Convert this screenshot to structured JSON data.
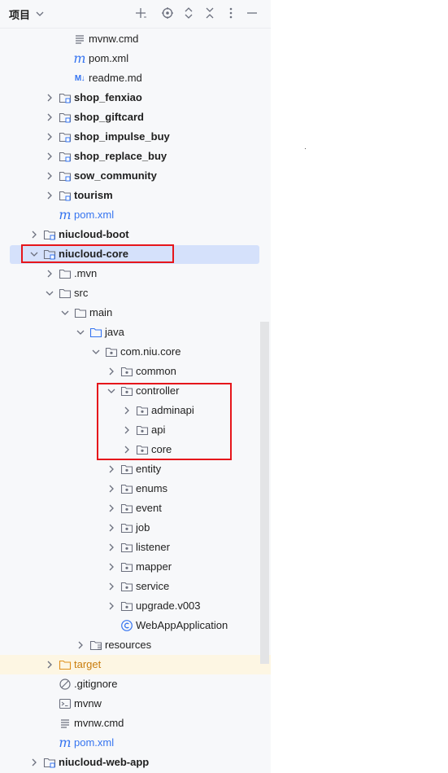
{
  "header": {
    "title": "项目",
    "icons": [
      "chevron-down-icon",
      "add-icon",
      "locate-icon",
      "expand-all-icon",
      "collapse-all-icon",
      "more-icon",
      "minimize-icon"
    ]
  },
  "tree": [
    {
      "label": "mvnw.cmd",
      "indent": 90,
      "arrow": "none",
      "icon": "lines-file-icon",
      "style": "normal"
    },
    {
      "label": "pom.xml",
      "indent": 90,
      "arrow": "none",
      "icon": "maven-icon",
      "style": "normal"
    },
    {
      "label": "readme.md",
      "indent": 90,
      "arrow": "none",
      "icon": "markdown-icon",
      "style": "normal"
    },
    {
      "label": "shop_fenxiao",
      "indent": 72,
      "arrow": "right",
      "icon": "module-folder-icon",
      "style": "bold"
    },
    {
      "label": "shop_giftcard",
      "indent": 72,
      "arrow": "right",
      "icon": "module-folder-icon",
      "style": "bold"
    },
    {
      "label": "shop_impulse_buy",
      "indent": 72,
      "arrow": "right",
      "icon": "module-folder-icon",
      "style": "bold"
    },
    {
      "label": "shop_replace_buy",
      "indent": 72,
      "arrow": "right",
      "icon": "module-folder-icon",
      "style": "bold"
    },
    {
      "label": "sow_community",
      "indent": 72,
      "arrow": "right",
      "icon": "module-folder-icon",
      "style": "bold"
    },
    {
      "label": "tourism",
      "indent": 72,
      "arrow": "right",
      "icon": "module-folder-icon",
      "style": "bold"
    },
    {
      "label": "pom.xml",
      "indent": 72,
      "arrow": "none",
      "icon": "maven-icon",
      "style": "blue"
    },
    {
      "label": "niucloud-boot",
      "indent": 53,
      "arrow": "right",
      "icon": "module-folder-icon",
      "style": "bold"
    },
    {
      "label": "niucloud-core",
      "indent": 53,
      "arrow": "down",
      "icon": "module-folder-icon",
      "style": "bold",
      "selected": true
    },
    {
      "label": ".mvn",
      "indent": 72,
      "arrow": "right",
      "icon": "folder-icon",
      "style": "normal"
    },
    {
      "label": "src",
      "indent": 72,
      "arrow": "down",
      "icon": "folder-icon",
      "style": "normal"
    },
    {
      "label": "main",
      "indent": 91,
      "arrow": "down",
      "icon": "folder-icon",
      "style": "normal"
    },
    {
      "label": "java",
      "indent": 110,
      "arrow": "down",
      "icon": "source-folder-icon",
      "style": "normal"
    },
    {
      "label": "com.niu.core",
      "indent": 129,
      "arrow": "down",
      "icon": "package-icon",
      "style": "normal"
    },
    {
      "label": "common",
      "indent": 148,
      "arrow": "right",
      "icon": "package-icon",
      "style": "normal"
    },
    {
      "label": "controller",
      "indent": 148,
      "arrow": "down",
      "icon": "package-icon",
      "style": "normal"
    },
    {
      "label": "adminapi",
      "indent": 167,
      "arrow": "right",
      "icon": "package-icon",
      "style": "normal"
    },
    {
      "label": "api",
      "indent": 167,
      "arrow": "right",
      "icon": "package-icon",
      "style": "normal"
    },
    {
      "label": "core",
      "indent": 167,
      "arrow": "right",
      "icon": "package-icon",
      "style": "normal"
    },
    {
      "label": "entity",
      "indent": 148,
      "arrow": "right",
      "icon": "package-icon",
      "style": "normal"
    },
    {
      "label": "enums",
      "indent": 148,
      "arrow": "right",
      "icon": "package-icon",
      "style": "normal"
    },
    {
      "label": "event",
      "indent": 148,
      "arrow": "right",
      "icon": "package-icon",
      "style": "normal"
    },
    {
      "label": "job",
      "indent": 148,
      "arrow": "right",
      "icon": "package-icon",
      "style": "normal"
    },
    {
      "label": "listener",
      "indent": 148,
      "arrow": "right",
      "icon": "package-icon",
      "style": "normal"
    },
    {
      "label": "mapper",
      "indent": 148,
      "arrow": "right",
      "icon": "package-icon",
      "style": "normal"
    },
    {
      "label": "service",
      "indent": 148,
      "arrow": "right",
      "icon": "package-icon",
      "style": "normal"
    },
    {
      "label": "upgrade.v003",
      "indent": 148,
      "arrow": "right",
      "icon": "package-icon",
      "style": "normal"
    },
    {
      "label": "WebAppApplication",
      "indent": 148,
      "arrow": "none",
      "icon": "class-icon",
      "style": "normal"
    },
    {
      "label": "resources",
      "indent": 110,
      "arrow": "right",
      "icon": "resources-folder-icon",
      "style": "normal"
    },
    {
      "label": "target",
      "indent": 72,
      "arrow": "right",
      "icon": "excluded-folder-icon",
      "style": "orange",
      "highlight": true
    },
    {
      "label": ".gitignore",
      "indent": 72,
      "arrow": "none",
      "icon": "ignore-file-icon",
      "style": "normal"
    },
    {
      "label": "mvnw",
      "indent": 72,
      "arrow": "none",
      "icon": "terminal-file-icon",
      "style": "normal"
    },
    {
      "label": "mvnw.cmd",
      "indent": 72,
      "arrow": "none",
      "icon": "lines-file-icon",
      "style": "normal"
    },
    {
      "label": "pom.xml",
      "indent": 72,
      "arrow": "none",
      "icon": "maven-icon",
      "style": "blue"
    },
    {
      "label": "niucloud-web-app",
      "indent": 53,
      "arrow": "right",
      "icon": "module-folder-icon",
      "style": "bold"
    }
  ],
  "colors": {
    "panel_bg": "#f7f8fa",
    "selection": "#d5e1fb",
    "annotation_red": "#e6161b",
    "link_blue": "#3574f0",
    "excluded_orange": "#c97d0e"
  }
}
